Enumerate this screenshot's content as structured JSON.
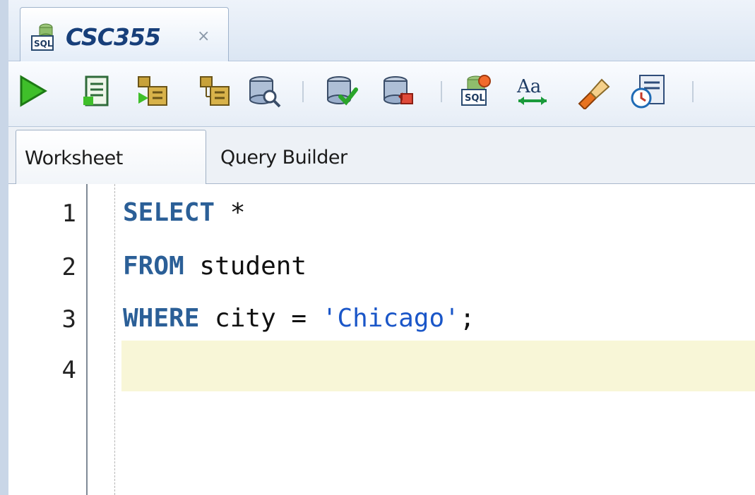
{
  "tab": {
    "title": "CSC355",
    "close_glyph": "×",
    "icon": "sql-worksheet-icon"
  },
  "toolbar": {
    "buttons": [
      {
        "name": "run-statement-button",
        "icon": "play-icon"
      },
      {
        "name": "run-script-button",
        "icon": "script-icon"
      },
      {
        "name": "autotrace-button",
        "icon": "autotrace-icon"
      },
      {
        "name": "explain-plan-button",
        "icon": "explain-plan-icon"
      },
      {
        "name": "sql-tuning-button",
        "icon": "tuning-icon"
      },
      {
        "name": "commit-button",
        "icon": "commit-icon"
      },
      {
        "name": "rollback-button",
        "icon": "rollback-icon"
      },
      {
        "name": "unshared-sql-button",
        "icon": "unshared-sql-icon"
      },
      {
        "name": "to-upper-lower-button",
        "icon": "text-case-icon"
      },
      {
        "name": "clear-button",
        "icon": "eraser-icon"
      },
      {
        "name": "sql-history-button",
        "icon": "history-icon"
      }
    ]
  },
  "subtabs": {
    "worksheet": "Worksheet",
    "query_builder": "Query Builder"
  },
  "editor": {
    "line_numbers": [
      "1",
      "2",
      "3",
      "4"
    ],
    "lines": [
      [
        {
          "t": "SELECT",
          "k": "kw"
        },
        {
          "t": " *",
          "k": "txt"
        }
      ],
      [
        {
          "t": "FROM",
          "k": "kw"
        },
        {
          "t": " student",
          "k": "txt"
        }
      ],
      [
        {
          "t": "WHERE",
          "k": "kw"
        },
        {
          "t": " city = ",
          "k": "txt"
        },
        {
          "t": "'Chicago'",
          "k": "str"
        },
        {
          "t": ";",
          "k": "txt"
        }
      ],
      []
    ]
  },
  "colors": {
    "keyword": "#2b5f97",
    "string": "#1a56c8",
    "current_line": "#f8f6d7",
    "tab_title": "#173f7a"
  }
}
